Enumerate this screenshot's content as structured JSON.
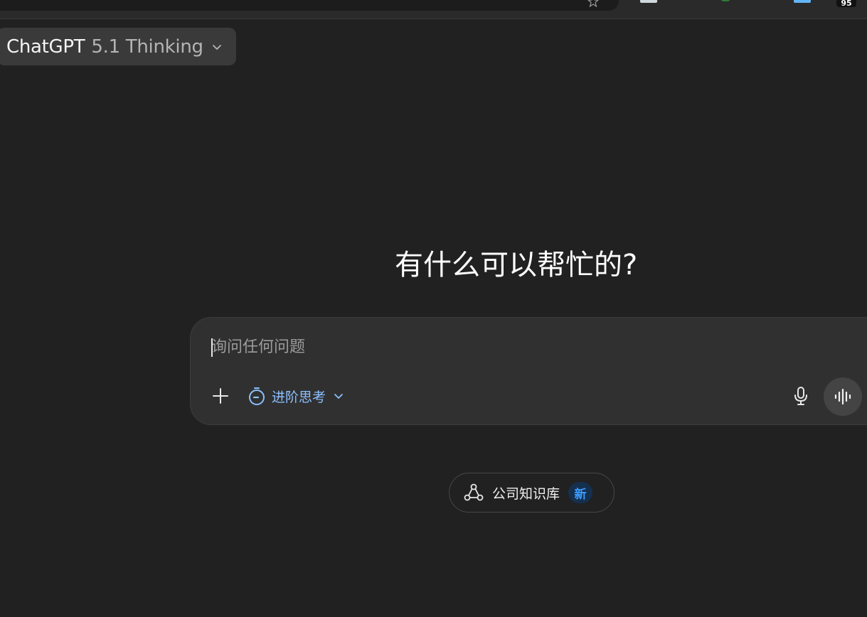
{
  "browser": {
    "extension_badge_count": "95"
  },
  "model_selector": {
    "name": "ChatGPT",
    "version": "5.1 Thinking"
  },
  "hero": {
    "title": "有什么可以帮忙的?"
  },
  "composer": {
    "placeholder": "询问任何问题",
    "value": "",
    "thinking_mode_label": "进阶思考",
    "icons": {
      "add": "plus-icon",
      "thinking": "timer-icon",
      "mic": "microphone-icon",
      "voice": "voice-waveform-icon"
    },
    "accent_color": "#8cc0ff"
  },
  "knowledge": {
    "label": "公司知识库",
    "badge": "新",
    "badge_color": "#3b9cff"
  },
  "colors": {
    "background": "#212121",
    "composer_bg": "#303030",
    "voice_button_bg": "#444444"
  }
}
